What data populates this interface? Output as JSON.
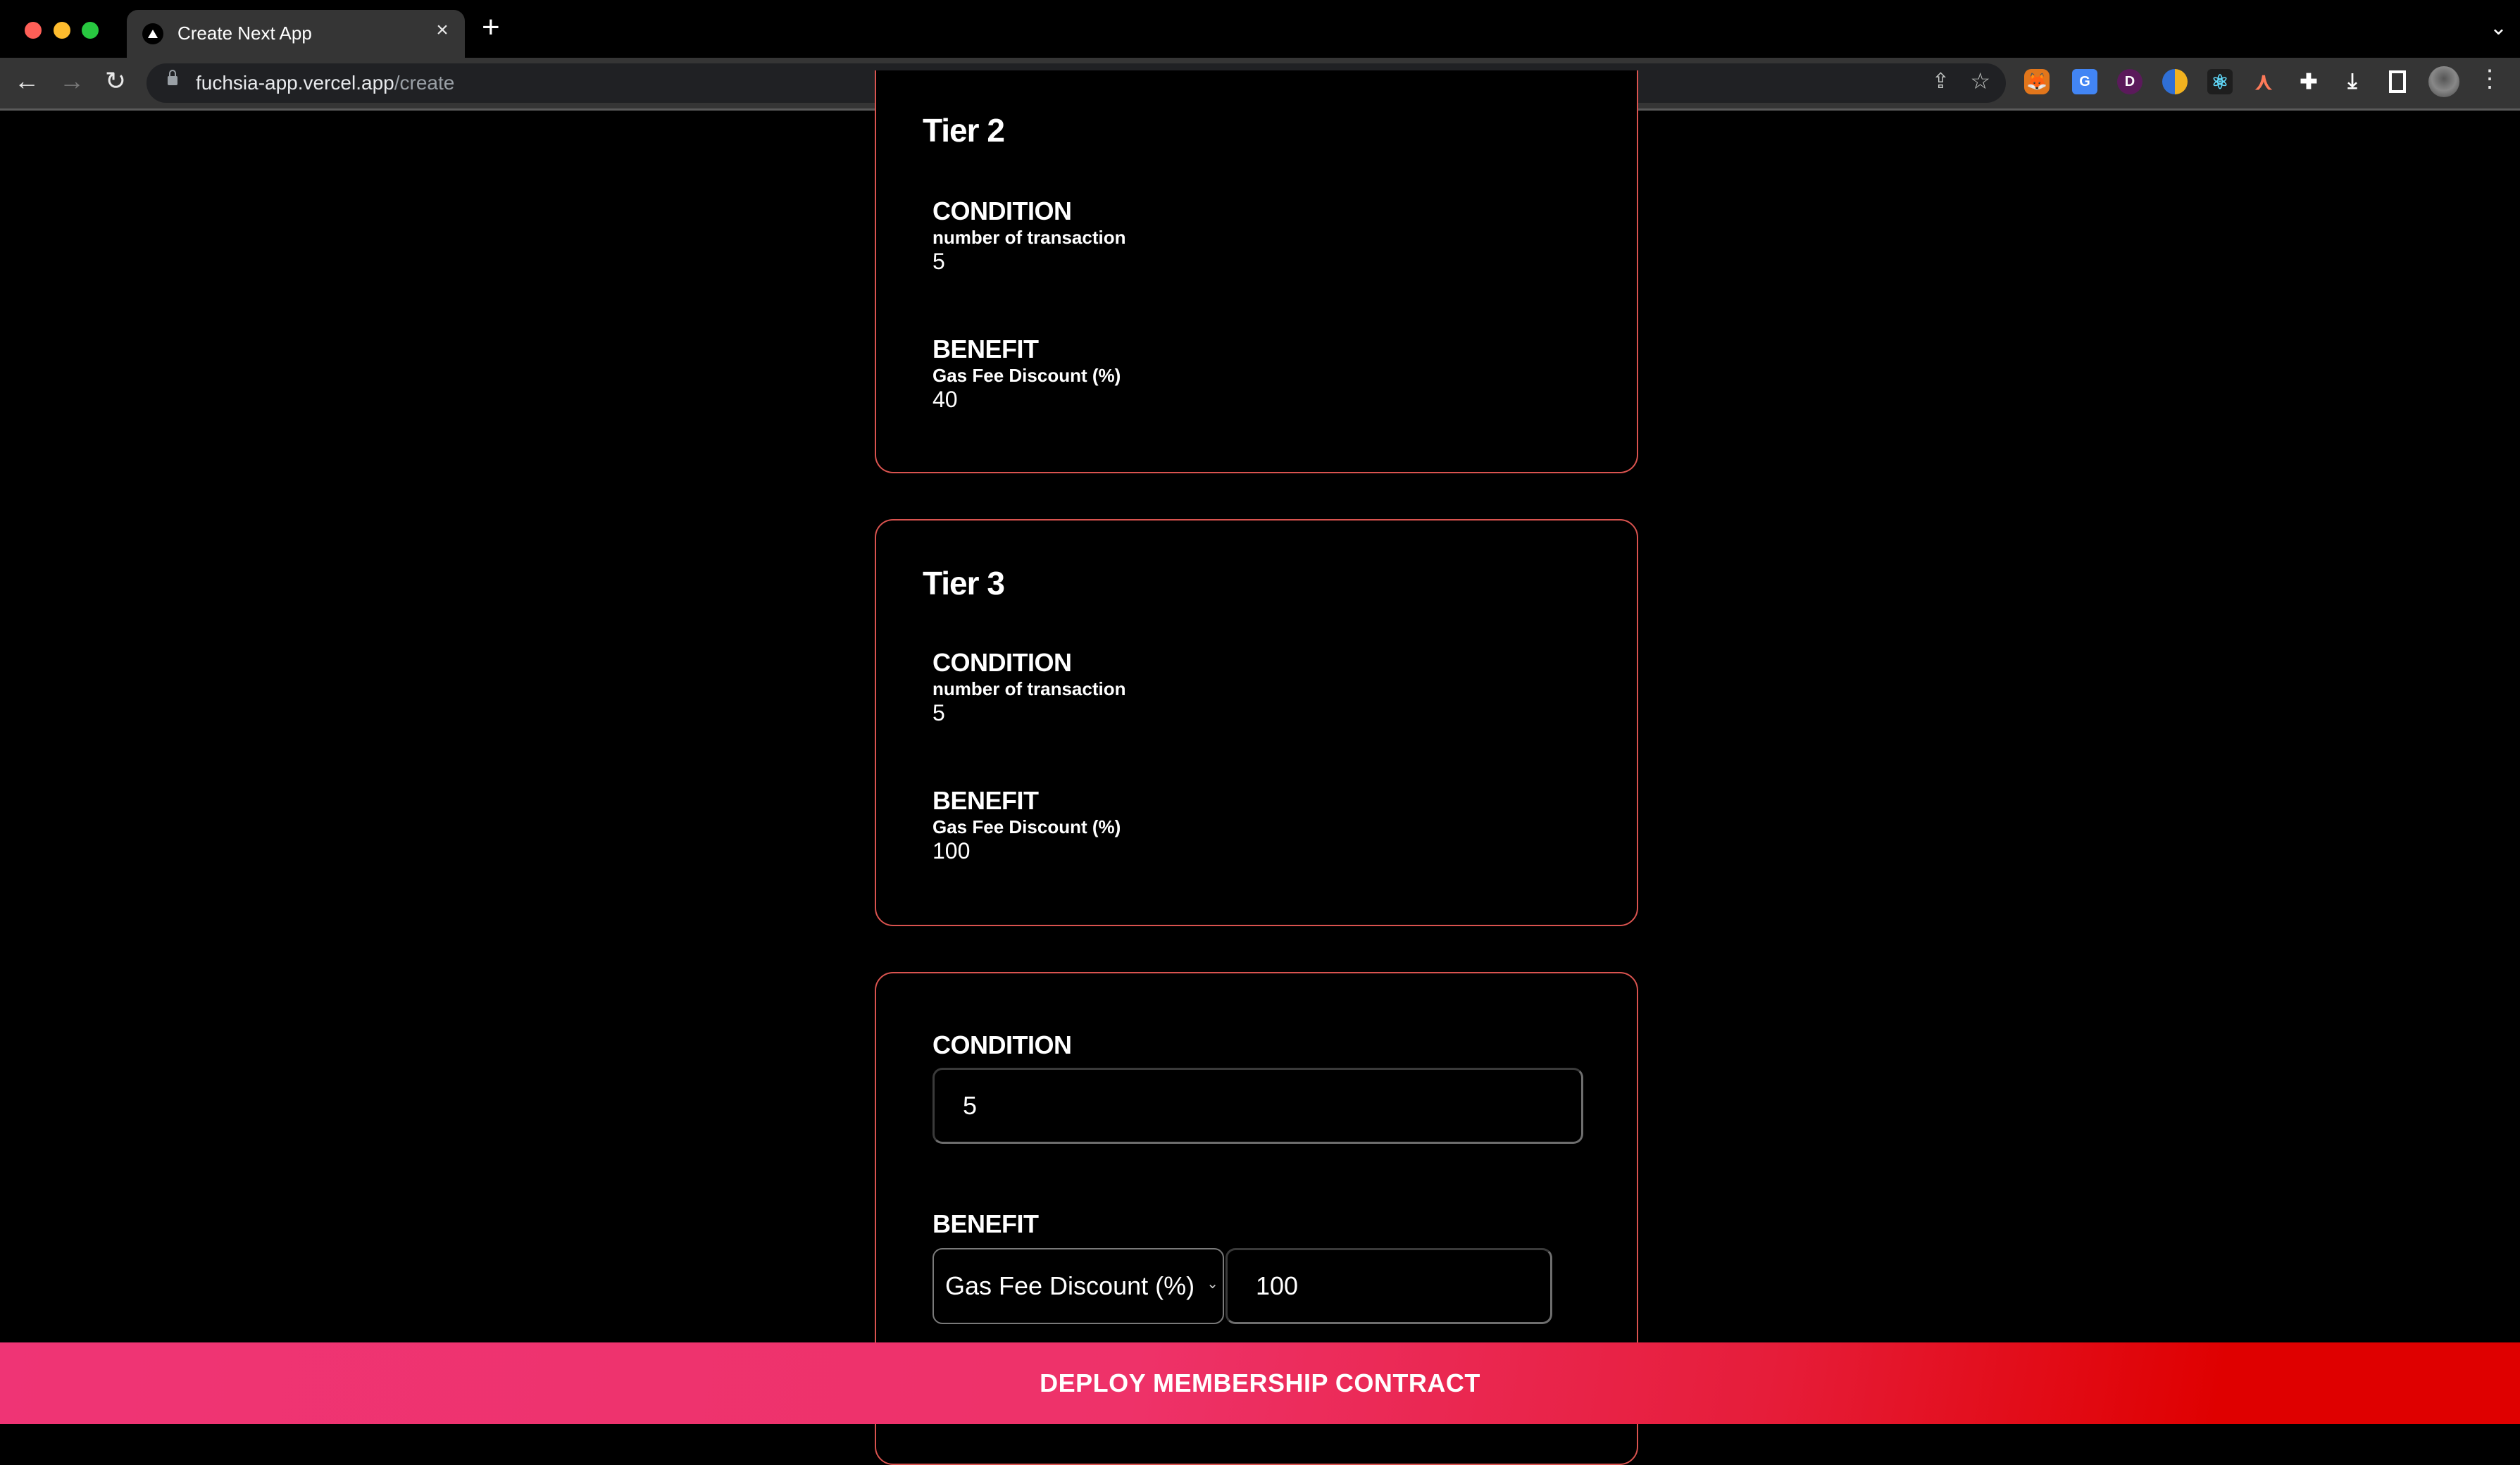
{
  "browser": {
    "tab_title": "Create Next App",
    "tab_close": "×",
    "new_tab": "+",
    "tab_menu": "⌄",
    "url_host": "fuchsia-app.vercel.app",
    "url_path": "/create",
    "nav": {
      "back": "←",
      "forward": "→",
      "reload": "↻"
    },
    "omnibox_icons": {
      "share": "⇪",
      "star": "☆"
    },
    "extensions": [
      {
        "name": "metamask",
        "glyph": "🦊"
      },
      {
        "name": "google-translate",
        "glyph": "G"
      },
      {
        "name": "purple-extension",
        "glyph": "D"
      },
      {
        "name": "brain-extension",
        "glyph": ""
      },
      {
        "name": "react-devtools",
        "glyph": "⚛"
      },
      {
        "name": "a-extension",
        "glyph": "⋏"
      },
      {
        "name": "extensions-puzzle",
        "glyph": "✚"
      },
      {
        "name": "downloads",
        "glyph": "⤓"
      },
      {
        "name": "side-panel",
        "glyph": ""
      }
    ],
    "menu": "⋮"
  },
  "tiers": [
    {
      "title": "Tier 2",
      "condition_heading": "CONDITION",
      "condition_type": "number of transaction",
      "condition_value": "5",
      "benefit_heading": "BENEFIT",
      "benefit_type": "Gas Fee Discount (%)",
      "benefit_value": "40"
    },
    {
      "title": "Tier 3",
      "condition_heading": "CONDITION",
      "condition_type": "number of transaction",
      "condition_value": "5",
      "benefit_heading": "BENEFIT",
      "benefit_type": "Gas Fee Discount (%)",
      "benefit_value": "100"
    }
  ],
  "new_tier_form": {
    "condition_heading": "CONDITION",
    "condition_value": "5",
    "benefit_heading": "BENEFIT",
    "benefit_type_selected": "Gas Fee Discount (%)",
    "benefit_value": "100"
  },
  "deploy_button": "DEPLOY MEMBERSHIP CONTRACT",
  "colors": {
    "card_border": "#d9534f",
    "deploy_gradient_start": "#ef3475",
    "deploy_gradient_end": "#df0000"
  }
}
